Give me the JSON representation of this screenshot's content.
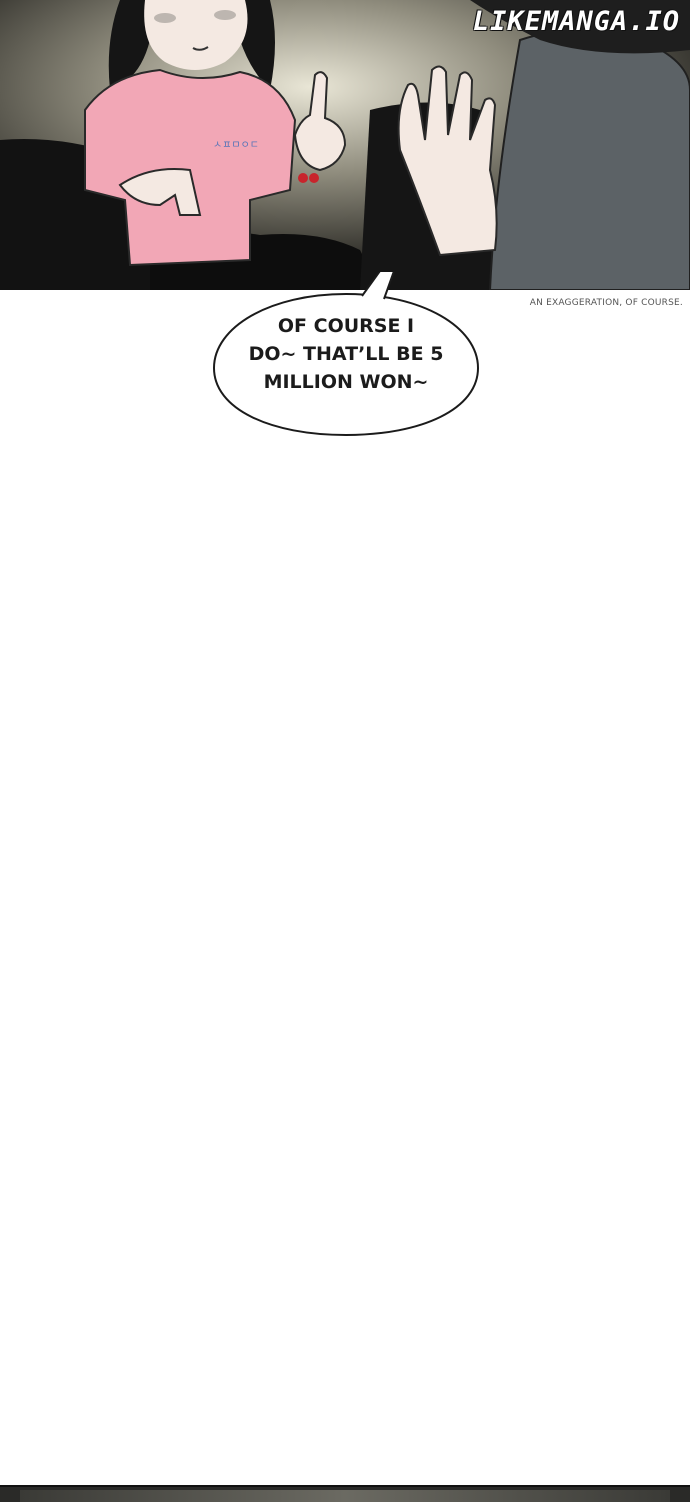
{
  "watermark": "LIKEMANGA.IO",
  "caption": "AN EXAGGERATION, OF COURSE.",
  "speech_bubble": {
    "lines": [
      "OF COURSE I",
      "DO~ THAT’LL BE 5",
      "MILLION WON~"
    ]
  },
  "shirt_text": "ㅅㅍㅁㅇㄷ",
  "colors": {
    "background": "#ffffff",
    "shirt": "#f2a7b6",
    "hair": "#151515",
    "jacket": "#5c6266",
    "scene_dark": "#2b2a25"
  }
}
